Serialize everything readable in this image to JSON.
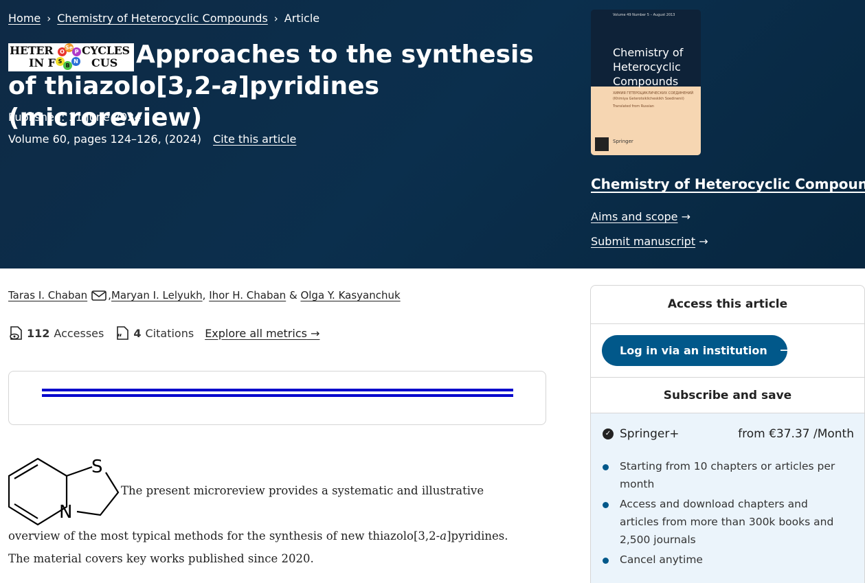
{
  "breadcrumb": {
    "home": "Home",
    "journal": "Chemistry of Heterocyclic Compounds",
    "current": "Article"
  },
  "logo": {
    "line1_left": "HETER",
    "line1_right": "CYCLES",
    "line2_left": "IN F",
    "line2_right": "CUS",
    "dots": [
      "O",
      "Se",
      "P",
      "S",
      "B",
      "N"
    ]
  },
  "article": {
    "title_pre": "Approaches to the synthesis of thiazolo[3,2-",
    "title_italic": "a",
    "title_post": "]pyridines (microreview)",
    "published": "Published: 11 June 2024",
    "volume": "Volume 60, pages 124–126, (2024)",
    "cite": "Cite this article"
  },
  "cover": {
    "volume_line": "Volume 49 Number 5 – August 2013",
    "title_lines": [
      "Chemistry of",
      "Heterocyclic",
      "Compounds"
    ],
    "subtitle": "ХИМИЯ ГЕТЕРОЦИКЛИЧЕСКИХ СОЕДИНЕНИЙ",
    "subtitle2": "(Khimiya Geterotsiklicheskikh Soedinenii)",
    "translated": "Translated from Russian",
    "publisher": "Springer"
  },
  "journal_panel": {
    "name": "Chemistry of Heterocyclic Compounds",
    "aims": "Aims and scope",
    "submit": "Submit manuscript"
  },
  "authors": [
    "Taras I. Chaban",
    "Maryan I. Lelyukh",
    "Ihor H. Chaban",
    "Olga Y. Kasyanchuk"
  ],
  "author_sep": {
    "comma": ",",
    "amp": "&"
  },
  "metrics": {
    "accesses_count": "112",
    "accesses_label": "Accesses",
    "citations_count": "4",
    "citations_label": "Citations",
    "explore": "Explore all metrics"
  },
  "abstract": {
    "structure_atoms": [
      "S",
      "N"
    ],
    "line1": "The present microreview provides a systematic and illustrative",
    "line2_pre": "overview of the most typical methods for the synthesis of new thiazolo[3,2-",
    "line2_italic": "a",
    "line2_post": "]pyridines.",
    "line3": "The material covers key works published since 2020."
  },
  "sidebar": {
    "access_title": "Access this article",
    "login_label": "Log in via an institution",
    "subscribe_title": "Subscribe and save",
    "plan_name": "Springer+",
    "plan_price": "from €37.37 /Month",
    "bullets": [
      "Starting from 10 chapters or articles per month",
      "Access and download chapters and articles from more than 300k books and 2,500 journals",
      "Cancel anytime"
    ]
  }
}
